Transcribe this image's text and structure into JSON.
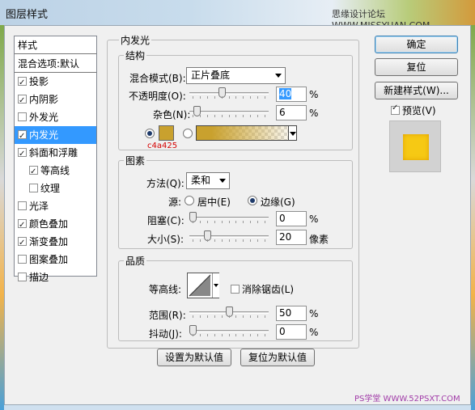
{
  "window": {
    "title": "图层样式",
    "watermark": "思缘设计论坛 WWW.MISSYUAN.COM",
    "bottom_watermark": "PS学堂 WWW.52PSXT.COM"
  },
  "style_list": {
    "header": "样式",
    "blend": "混合选项:默认",
    "items": [
      {
        "label": "投影",
        "checked": true
      },
      {
        "label": "内阴影",
        "checked": true
      },
      {
        "label": "外发光",
        "checked": false
      },
      {
        "label": "内发光",
        "checked": true,
        "selected": true
      },
      {
        "label": "斜面和浮雕",
        "checked": true
      },
      {
        "label": "等高线",
        "checked": true,
        "indent": true
      },
      {
        "label": "纹理",
        "checked": false,
        "indent": true
      },
      {
        "label": "光泽",
        "checked": false
      },
      {
        "label": "颜色叠加",
        "checked": true
      },
      {
        "label": "渐变叠加",
        "checked": true
      },
      {
        "label": "图案叠加",
        "checked": false
      },
      {
        "label": "描边",
        "checked": false
      }
    ]
  },
  "panel": {
    "title": "内发光",
    "structure": {
      "title": "结构",
      "blend_mode_label": "混合模式(B):",
      "blend_mode_value": "正片叠底",
      "opacity_label": "不透明度(O):",
      "opacity_value": "40",
      "noise_label": "杂色(N):",
      "noise_value": "6",
      "percent": "%",
      "color_annotation": "c4a425"
    },
    "elements": {
      "title": "图素",
      "method_label": "方法(Q):",
      "method_value": "柔和",
      "source_label": "源:",
      "source_center": "居中(E)",
      "source_edge": "边缘(G)",
      "choke_label": "阻塞(C):",
      "choke_value": "0",
      "size_label": "大小(S):",
      "size_value": "20",
      "size_unit": "像素",
      "percent": "%"
    },
    "quality": {
      "title": "品质",
      "contour_label": "等高线:",
      "antialias_label": "消除锯齿(L)",
      "range_label": "范围(R):",
      "range_value": "50",
      "jitter_label": "抖动(J):",
      "jitter_value": "0",
      "percent": "%"
    },
    "make_default": "设置为默认值",
    "reset_default": "复位为默认值"
  },
  "buttons": {
    "ok": "确定",
    "reset": "复位",
    "new_style": "新建样式(W)...",
    "preview_label": "预览(V)"
  },
  "colors": {
    "glow": "#c9a12e",
    "selection": "#3399ff",
    "preview_fill": "#f6c914"
  },
  "slider_levels": {
    "opacity": 40,
    "noise": 6,
    "choke": 0,
    "size": 20,
    "range": 50,
    "jitter": 0
  }
}
